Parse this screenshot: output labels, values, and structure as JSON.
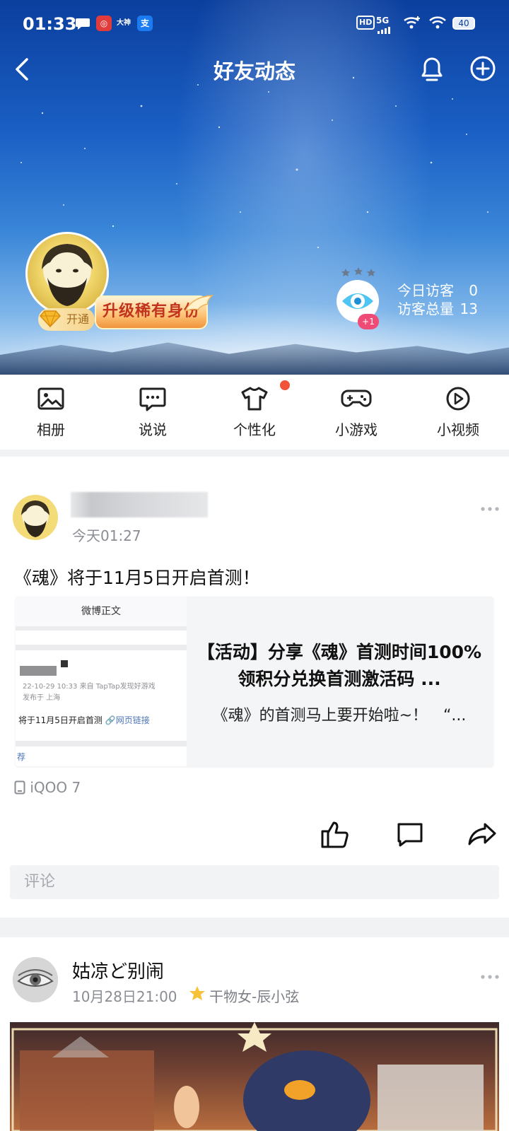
{
  "status_bar": {
    "time": "01:33",
    "left_icons": [
      "chat-bubble-icon",
      "netease-music-icon",
      "dashen-app-icon",
      "alipay-icon"
    ],
    "app_label_dashen": "大神",
    "network": "5G",
    "hd": "HD",
    "battery": "40"
  },
  "header": {
    "title": "好友动态",
    "vip_label": "开通",
    "upgrade_label": "升级稀有身份",
    "visitor_badge": "+1",
    "today_visitors_label": "今日访客",
    "today_visitors_value": "0",
    "total_visitors_label": "访客总量",
    "total_visitors_value": "13"
  },
  "shortcuts": [
    {
      "label": "相册",
      "icon": "photo-album-icon"
    },
    {
      "label": "说说",
      "icon": "speech-bubble-icon"
    },
    {
      "label": "个性化",
      "icon": "tshirt-icon"
    },
    {
      "label": "小游戏",
      "icon": "gamepad-icon"
    },
    {
      "label": "小视频",
      "icon": "play-circle-icon"
    }
  ],
  "post1": {
    "time": "今天01:27",
    "text": "《魂》将于11月5日开启首测！",
    "card": {
      "thumb_header": "微博正文",
      "thumb_meta_line1": "22-10-29 10:33  来自 TapTap发现好游戏",
      "thumb_meta_line2": "发布于 上海",
      "thumb_text": "将于11月5日开启首测",
      "thumb_link": "网页链接",
      "thumb_tag": "荐",
      "title": "【活动】分享《魂》首测时间100%领积分兑换首测激活码 ...",
      "desc": "《魂》的首测马上要开始啦~！　“..."
    },
    "device": "iQOO 7",
    "comment_placeholder": "评论"
  },
  "post2": {
    "name": "姑凉ど别闹",
    "time": "10月28日21:00",
    "tag": "干物女-辰小弦"
  }
}
